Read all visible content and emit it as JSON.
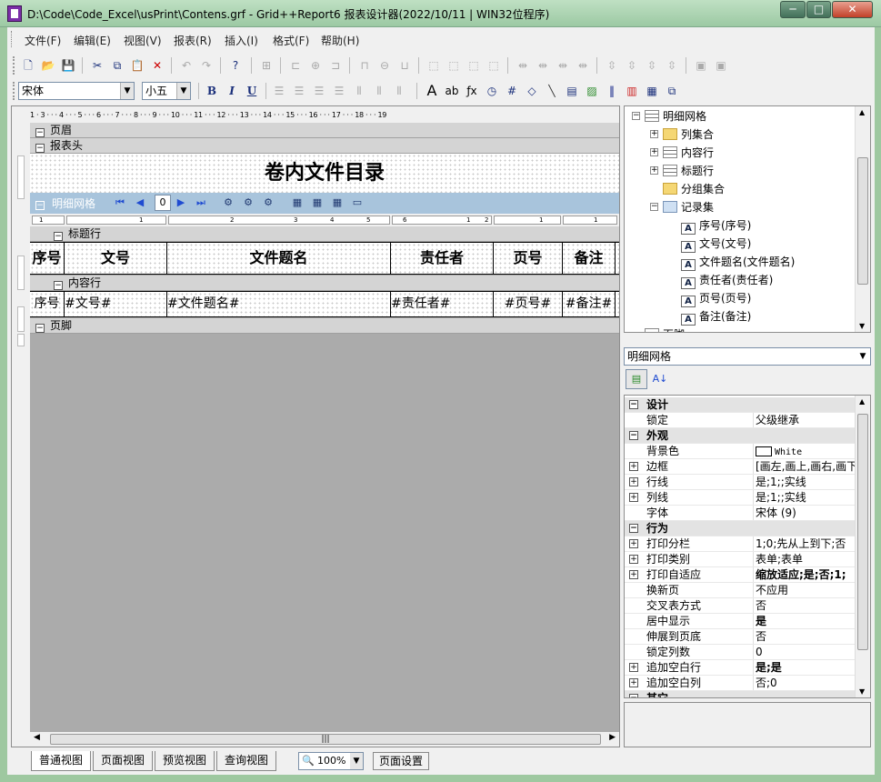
{
  "window": {
    "title": "D:\\Code\\Code_Excel\\usPrint\\Contens.grf - Grid++Report6 报表设计器(2022/10/11 | WIN32位程序)",
    "min": "─",
    "max": "□",
    "close": "✕"
  },
  "menu": [
    "文件(F)",
    "编辑(E)",
    "视图(V)",
    "报表(R)",
    "插入(I)",
    "格式(F)",
    "帮助(H)"
  ],
  "format_bar": {
    "font_name": "宋体",
    "font_size": "小五"
  },
  "bands": {
    "page_header": "页眉",
    "report_header": "报表头",
    "grid_name": "明细网格",
    "title_row": "标题行",
    "content_row": "内容行",
    "page_footer": "页脚"
  },
  "report_title": "卷内文件目录",
  "grid_page_number": "0",
  "columns": [
    {
      "header": "序号",
      "content": "序号"
    },
    {
      "header": "文号",
      "content": "#文号#"
    },
    {
      "header": "文件题名",
      "content": "#文件题名#"
    },
    {
      "header": "责任者",
      "content": "#责任者#"
    },
    {
      "header": "页号",
      "content": "#页号#"
    },
    {
      "header": "备注",
      "content": "#备注#"
    }
  ],
  "ruler": {
    "top": "1 · 3 · · · 4 · · · 5 · · · 6 · · · 7 · · · 8 · · · 9 · · · 10 · · · 11 · · · 12 · · · 13 · · · 14 · · · 15 · · · 16 · · · 17 · · · 18 · · · 19",
    "sub": [
      "1",
      "1",
      "2",
      "3",
      "4",
      "5",
      "6",
      "1",
      "2",
      "1",
      "1"
    ]
  },
  "tree": {
    "root": "明细网格",
    "items": [
      {
        "label": "列集合",
        "type": "folder"
      },
      {
        "label": "内容行",
        "type": "table"
      },
      {
        "label": "标题行",
        "type": "table"
      },
      {
        "label": "分组集合",
        "type": "folder"
      },
      {
        "label": "记录集",
        "type": "rec"
      }
    ],
    "fields": [
      "序号(序号)",
      "文号(文号)",
      "文件题名(文件题名)",
      "责任者(责任者)",
      "页号(页号)",
      "备注(备注)"
    ],
    "footer_partial": "页脚"
  },
  "object_selector": "明细网格",
  "property_groups": [
    {
      "name": "设计",
      "props": [
        {
          "name": "锁定",
          "value": "父级继承"
        }
      ]
    },
    {
      "name": "外观",
      "props": [
        {
          "name": "背景色",
          "value": "White",
          "swatch": true
        },
        {
          "name": "边框",
          "value": "[画左,画上,画右,画下]",
          "expandable": true
        },
        {
          "name": "行线",
          "value": "是;1;;实线",
          "expandable": true
        },
        {
          "name": "列线",
          "value": "是;1;;实线",
          "expandable": true
        },
        {
          "name": "字体",
          "value": "宋体 (9)"
        }
      ]
    },
    {
      "name": "行为",
      "props": [
        {
          "name": "打印分栏",
          "value": "1;0;先从上到下;否",
          "expandable": true
        },
        {
          "name": "打印类别",
          "value": "表单;表单",
          "expandable": true
        },
        {
          "name": "打印自适应",
          "value": "缩放适应;是;否;1;",
          "expandable": true,
          "bold": true
        },
        {
          "name": "换新页",
          "value": "不应用"
        },
        {
          "name": "交叉表方式",
          "value": "否"
        },
        {
          "name": "居中显示",
          "value": "是",
          "bold": true
        },
        {
          "name": "伸展到页底",
          "value": "否"
        },
        {
          "name": "锁定列数",
          "value": "0"
        },
        {
          "name": "追加空白行",
          "value": "是;是",
          "expandable": true,
          "bold": true
        },
        {
          "name": "追加空白列",
          "value": "否;0",
          "expandable": true
        }
      ]
    },
    {
      "name": "其它",
      "props": []
    }
  ],
  "view_tabs": [
    "普通视图",
    "页面视图",
    "预览视图",
    "查询视图"
  ],
  "zoom": "100%",
  "page_setup": "页面设置"
}
